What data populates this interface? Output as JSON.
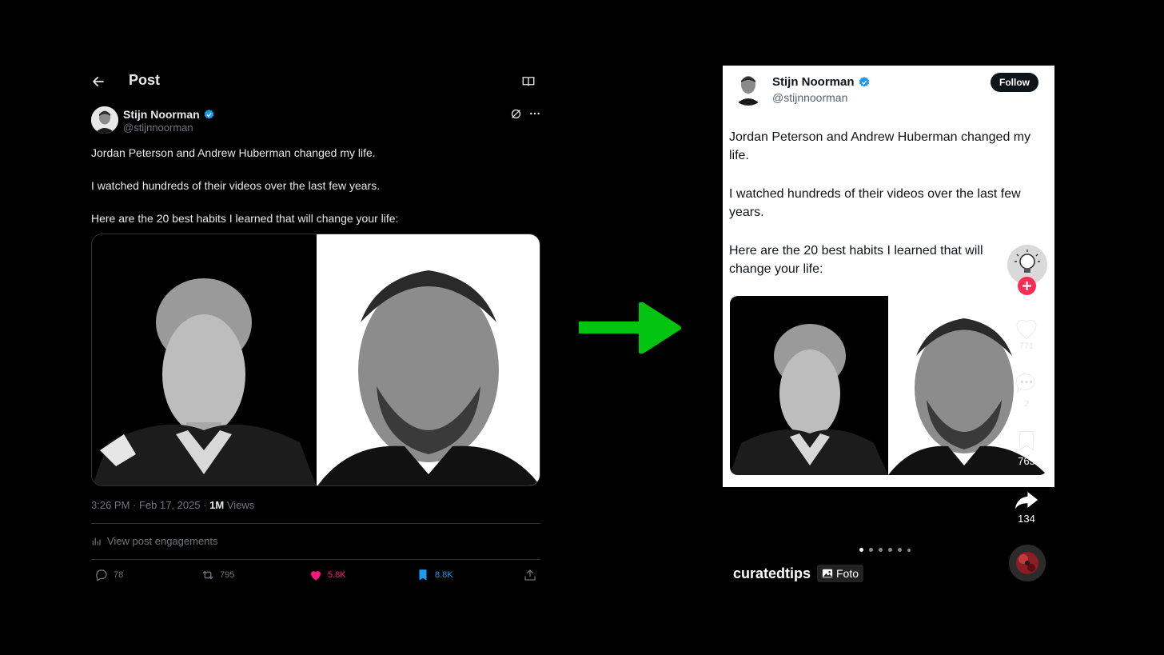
{
  "left_post": {
    "header_title": "Post",
    "author": {
      "name": "Stijn Noorman",
      "handle": "@stijnnoorman"
    },
    "paragraphs": [
      "Jordan Peterson and Andrew Huberman changed my life.",
      "I watched hundreds of their videos over the last few years.",
      "Here are the 20 best habits I learned that will change your life:"
    ],
    "timestamp": "3:26 PM · Feb 17, 2025 · ",
    "views_count": "1M",
    "views_label": " Views",
    "engagements_label": "View post engagements",
    "actions": {
      "replies": "78",
      "reposts": "795",
      "likes": "5.8K",
      "bookmarks": "8.8K"
    }
  },
  "right_post": {
    "author": {
      "name": "Stijn Noorman",
      "handle": "@stijnnoorman"
    },
    "follow_label": "Follow",
    "paragraphs": [
      "Jordan Peterson and Andrew Huberman changed my life.",
      "I watched hundreds of their videos over the last few years.",
      "Here are the 20 best habits I learned that will change your life:"
    ],
    "side": {
      "likes": "771",
      "comments": "2",
      "saves": "765",
      "shares": "134"
    },
    "username": "curatedtips",
    "badge_label": "Foto",
    "carousel": {
      "total": 6,
      "active_index": 0
    }
  },
  "colors": {
    "arrow": "#00c410",
    "like": "#f91880",
    "bookmark": "#1d9bf0",
    "verified": "#1d9bf0",
    "follow_plus": "#fe2c55"
  }
}
